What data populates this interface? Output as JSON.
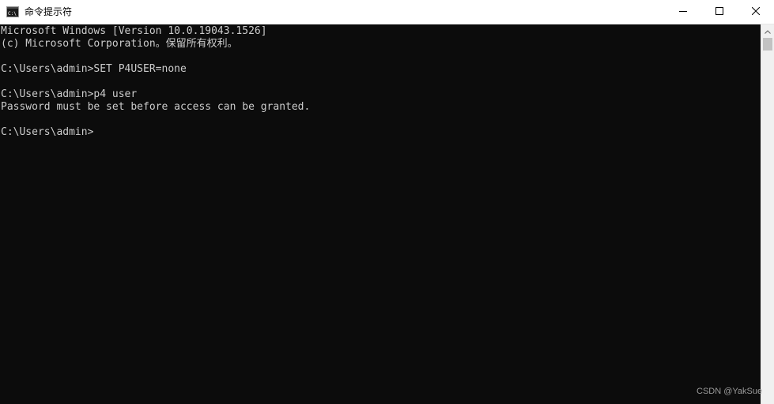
{
  "window": {
    "title": "命令提示符",
    "app_icon": "cmd-icon",
    "controls": {
      "minimize_icon": "minimize-icon",
      "maximize_icon": "maximize-icon",
      "close_icon": "close-icon"
    }
  },
  "console": {
    "lines": [
      "Microsoft Windows [Version 10.0.19043.1526]",
      "(c) Microsoft Corporation。保留所有权利。",
      "",
      "C:\\Users\\admin>SET P4USER=none",
      "",
      "C:\\Users\\admin>p4 user",
      "Password must be set before access can be granted.",
      "",
      "C:\\Users\\admin>"
    ]
  },
  "scrollbar": {
    "up_icon": "scroll-up-arrow-icon"
  },
  "watermark": "CSDN @YakSue",
  "colors": {
    "console_background": "#0c0c0c",
    "console_text": "#cccccc",
    "titlebar_background": "#ffffff"
  }
}
